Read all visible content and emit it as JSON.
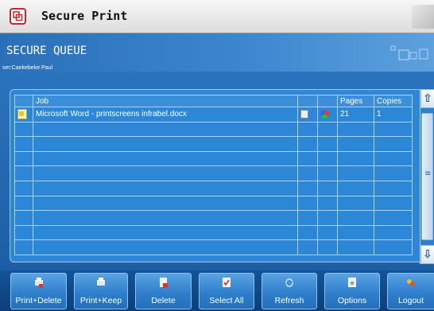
{
  "app": {
    "title": "Secure Print"
  },
  "header": {
    "title": "SECURE QUEUE",
    "user_label": "ser:Caekebeke Paul"
  },
  "table": {
    "columns": [
      "",
      "Job",
      "",
      "",
      "Pages",
      "Copies"
    ],
    "rows": [
      {
        "job": "Microsoft Word - printscreens infrabel.docx",
        "pages": "21",
        "copies": "1"
      }
    ]
  },
  "toolbar": {
    "buttons": [
      {
        "label": "Print+Delete",
        "icon": "print-delete-icon"
      },
      {
        "label": "Print+Keep",
        "icon": "print-keep-icon"
      },
      {
        "label": "Delete",
        "icon": "delete-icon"
      },
      {
        "label": "Select All",
        "icon": "select-all-icon"
      },
      {
        "label": "Refresh",
        "icon": "refresh-icon"
      },
      {
        "label": "Options",
        "icon": "options-icon"
      },
      {
        "label": "Logout",
        "icon": "logout-icon"
      }
    ]
  },
  "colors": {
    "accent": "#2e86d4",
    "title_icon": "#c1272d",
    "toolbar": "#12549a"
  }
}
